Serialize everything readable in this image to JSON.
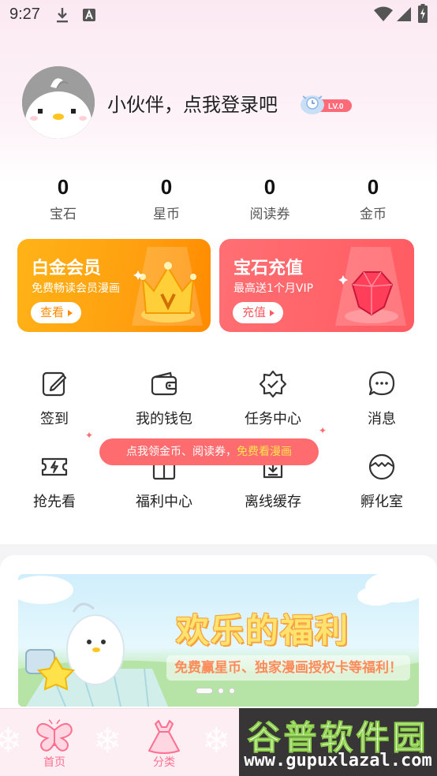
{
  "status_bar": {
    "time": "9:27"
  },
  "profile": {
    "login_prompt": "小伙伴，点我登录吧",
    "level": "LV.0"
  },
  "stats": [
    {
      "value": "0",
      "label": "宝石"
    },
    {
      "value": "0",
      "label": "星币"
    },
    {
      "value": "0",
      "label": "阅读券"
    },
    {
      "value": "0",
      "label": "金币"
    }
  ],
  "cards": {
    "vip": {
      "title": "白金会员",
      "subtitle": "免费畅读会员漫画",
      "button": "查看"
    },
    "gem": {
      "title": "宝石充值",
      "subtitle": "最高送1个月VIP",
      "button": "充值"
    }
  },
  "grid": [
    {
      "label": "签到",
      "icon": "edit-icon"
    },
    {
      "label": "我的钱包",
      "icon": "wallet-icon"
    },
    {
      "label": "任务中心",
      "icon": "badge-check-icon"
    },
    {
      "label": "消息",
      "icon": "chat-icon"
    },
    {
      "label": "抢先看",
      "icon": "ticket-icon"
    },
    {
      "label": "福利中心",
      "icon": "gift-icon"
    },
    {
      "label": "离线缓存",
      "icon": "download-icon"
    },
    {
      "label": "孵化室",
      "icon": "egg-icon"
    }
  ],
  "tooltip": {
    "prefix": "点我领金币、阅读券，",
    "highlight": "免费看漫画"
  },
  "banner": {
    "title": "欢乐的福利",
    "subtitle": "免费赢星币、独家漫画授权卡等福利！"
  },
  "tabs": [
    {
      "label": "首页",
      "icon": "butterfly-icon"
    },
    {
      "label": "分类",
      "icon": "dress-icon"
    }
  ],
  "watermark": {
    "title": "谷普软件园",
    "url": "www.gupuxlazal.com"
  },
  "colors": {
    "accent": "#ff6f8f",
    "vip": "#ff9f0f",
    "gem": "#ff5b62",
    "tooltip": "#ff6c6f"
  }
}
